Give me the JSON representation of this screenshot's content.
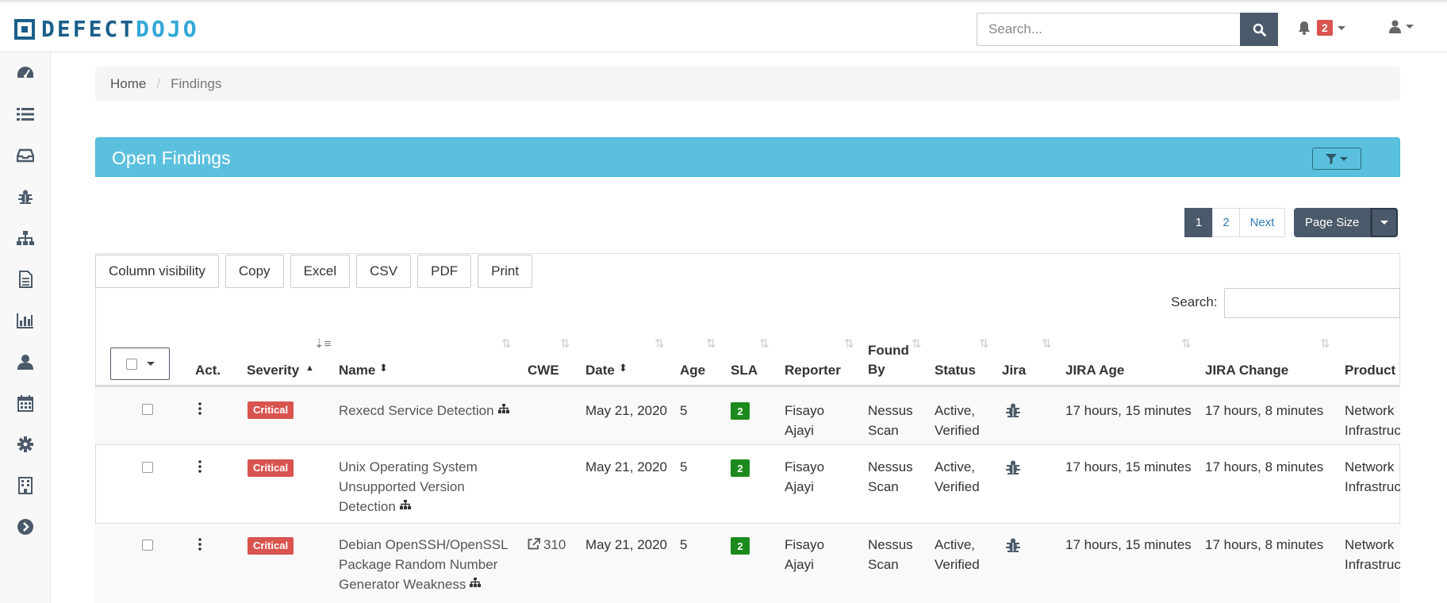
{
  "brand": {
    "part1": "DEFECT",
    "part2": "DOJO"
  },
  "nav": {
    "search_placeholder": "Search...",
    "notification_count": "2",
    "icons": [
      "search-icon",
      "bell-icon",
      "user-icon"
    ]
  },
  "sidebar": {
    "items": [
      {
        "icon": "dashboard-icon"
      },
      {
        "icon": "list-icon"
      },
      {
        "icon": "inbox-icon"
      },
      {
        "icon": "bug-icon"
      },
      {
        "icon": "sitemap-icon"
      },
      {
        "icon": "file-icon"
      },
      {
        "icon": "bar-chart-icon"
      },
      {
        "icon": "user-icon"
      },
      {
        "icon": "calendar-icon"
      },
      {
        "icon": "gear-icon"
      },
      {
        "icon": "building-icon"
      },
      {
        "icon": "arrow-circle-right-icon"
      }
    ]
  },
  "breadcrumb": {
    "home": "Home",
    "current": "Findings"
  },
  "panel": {
    "title": "Open Findings"
  },
  "pagination": {
    "pages": [
      "1",
      "2"
    ],
    "next": "Next",
    "page_size": "Page Size"
  },
  "dt_buttons": [
    "Column visibility",
    "Copy",
    "Excel",
    "CSV",
    "PDF",
    "Print"
  ],
  "table_search_label": "Search:",
  "columns": {
    "act": "Act.",
    "severity": "Severity",
    "name": "Name",
    "cwe": "CWE",
    "date": "Date",
    "age": "Age",
    "sla": "SLA",
    "reporter": "Reporter",
    "found_by_1": "Found",
    "found_by_2": "By",
    "status": "Status",
    "jira": "Jira",
    "jira_age": "JIRA Age",
    "jira_change": "JIRA Change",
    "product": "Product"
  },
  "rows": [
    {
      "severity": "Critical",
      "name_lines": [
        "Rexecd Service Detection"
      ],
      "cwe": "",
      "date": "May 21, 2020",
      "age": "5",
      "sla": "2",
      "reporter_1": "Fisayo",
      "reporter_2": "Ajayi",
      "found_1": "Nessus",
      "found_2": "Scan",
      "status_1": "Active,",
      "status_2": "Verified",
      "jira_age": "17 hours, 15 minutes",
      "jira_change": "17 hours, 8 minutes",
      "product_1": "Network",
      "product_2": "Infrastruc"
    },
    {
      "severity": "Critical",
      "name_lines": [
        "Unix Operating System",
        "Unsupported Version",
        "Detection"
      ],
      "cwe": "",
      "date": "May 21, 2020",
      "age": "5",
      "sla": "2",
      "reporter_1": "Fisayo",
      "reporter_2": "Ajayi",
      "found_1": "Nessus",
      "found_2": "Scan",
      "status_1": "Active,",
      "status_2": "Verified",
      "jira_age": "17 hours, 15 minutes",
      "jira_change": "17 hours, 8 minutes",
      "product_1": "Network",
      "product_2": "Infrastruc"
    },
    {
      "severity": "Critical",
      "name_lines": [
        "Debian OpenSSH/OpenSSL",
        "Package Random Number",
        "Generator Weakness"
      ],
      "cwe": "310",
      "date": "May 21, 2020",
      "age": "5",
      "sla": "2",
      "reporter_1": "Fisayo",
      "reporter_2": "Ajayi",
      "found_1": "Nessus",
      "found_2": "Scan",
      "status_1": "Active,",
      "status_2": "Verified",
      "jira_age": "17 hours, 15 minutes",
      "jira_change": "17 hours, 8 minutes",
      "product_1": "Network",
      "product_2": "Infrastruc"
    }
  ]
}
